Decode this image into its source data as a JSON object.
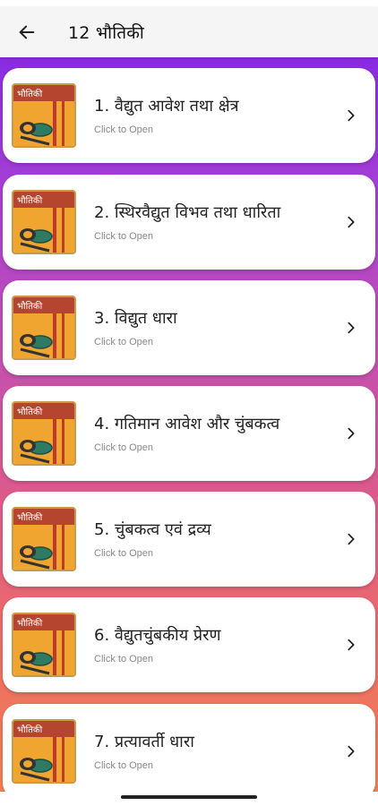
{
  "app_bar": {
    "title": "12 भौतिकी",
    "back_icon": "arrow-left-icon"
  },
  "thumbnail": {
    "label": "भौतिकी",
    "colors": {
      "top": "#b5452f",
      "body": "#f0a531",
      "spine": "#c0392b",
      "bowl": "#2f7a63"
    }
  },
  "chapters": [
    {
      "title": "1. वैद्युत आवेश तथा क्षेत्र",
      "subtitle": "Click to Open"
    },
    {
      "title": "2. स्थिरवैद्युत विभव तथा धारिता",
      "subtitle": "Click to Open"
    },
    {
      "title": "3. विद्युत धारा",
      "subtitle": "Click to Open"
    },
    {
      "title": "4. गतिमान आवेश और चुंबकत्व",
      "subtitle": "Click to Open"
    },
    {
      "title": "5. चुंबकत्व एवं द्रव्य",
      "subtitle": "Click to Open"
    },
    {
      "title": "6. वैद्युतचुंबकीय प्रेरण",
      "subtitle": "Click to Open"
    },
    {
      "title": "7. प्रत्यावर्ती धारा",
      "subtitle": "Click to Open"
    }
  ],
  "colors": {
    "gradient_top": "#8a2be2",
    "gradient_bottom": "#f2834e",
    "card_bg": "#ffffff"
  }
}
